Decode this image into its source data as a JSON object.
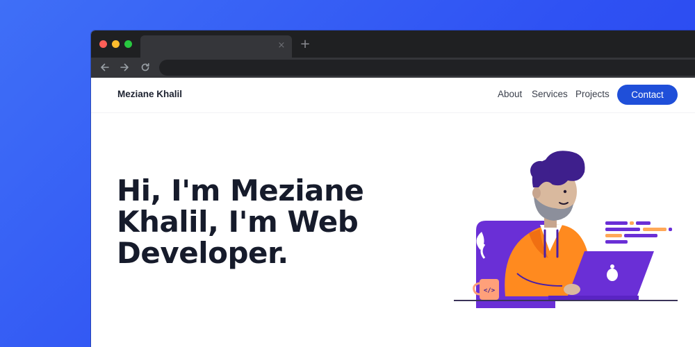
{
  "browser": {
    "tab_close_glyph": "×",
    "new_tab_glyph": "+",
    "icons": [
      "back-arrow-icon",
      "forward-arrow-icon",
      "reload-icon"
    ]
  },
  "site": {
    "brand": "Meziane Khalil",
    "nav": {
      "about": "About",
      "services": "Services",
      "projects": "Projects",
      "contact": "Contact"
    }
  },
  "hero": {
    "line1": "Hi, I'm Meziane",
    "line2": "Khalil, I'm Web",
    "line3": "Developer.",
    "mug_label": "</>"
  },
  "colors": {
    "background": "#2f52f3",
    "accent": "#1f4fd9",
    "illustration_purple": "#6a2fd6",
    "illustration_orange": "#ff8a1f"
  }
}
